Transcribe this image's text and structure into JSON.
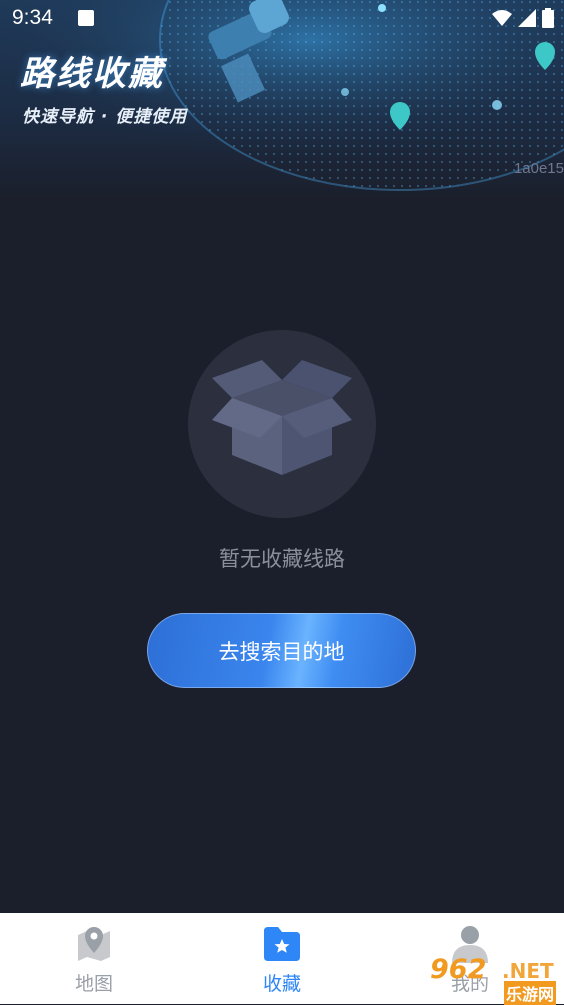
{
  "status_bar": {
    "time": "9:34"
  },
  "header": {
    "title": "路线收藏",
    "subtitle": "快速导航 · 便捷使用",
    "version": "1a0e15"
  },
  "empty_state": {
    "message": "暂无收藏线路",
    "action_label": "去搜索目的地"
  },
  "tabbar": {
    "tabs": [
      {
        "label": "地图",
        "icon": "map-pin-icon",
        "active": false
      },
      {
        "label": "收藏",
        "icon": "folder-star-icon",
        "active": true
      },
      {
        "label": "我的",
        "icon": "person-icon",
        "active": false
      }
    ],
    "active_color": "#2f86f6",
    "inactive_color": "#9aa0a8"
  },
  "watermark": {
    "brand_number": "962",
    "brand_domain": ".NET",
    "brand_cn": "乐游网"
  }
}
